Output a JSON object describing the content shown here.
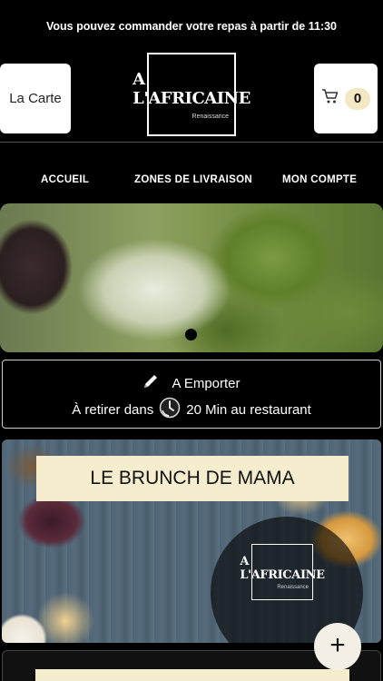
{
  "notice": "Vous pouvez commander votre repas à partir de 11:30",
  "header": {
    "carte_label": "La Carte",
    "logo_name": "A L'AFRICAINE",
    "logo_sub": "Renaissance",
    "cart_count": "0",
    "cart_icon": "cart-icon"
  },
  "nav": {
    "items": [
      "ACCUEIL",
      "ZONES DE LIVRAISON",
      "MON COMPTE"
    ]
  },
  "carousel": {
    "active_index": 0,
    "count": 1
  },
  "pickup": {
    "mode": "A Emporter",
    "prefix": "À retirer dans",
    "time": "20 Min au restaurant",
    "edit_icon": "pencil-icon",
    "clock_icon": "clock-icon"
  },
  "card": {
    "title": "LE BRUNCH DE MAMA",
    "logo_name": "A L'AFRICAINE",
    "logo_sub": "Renaissance",
    "add_label": "+"
  }
}
